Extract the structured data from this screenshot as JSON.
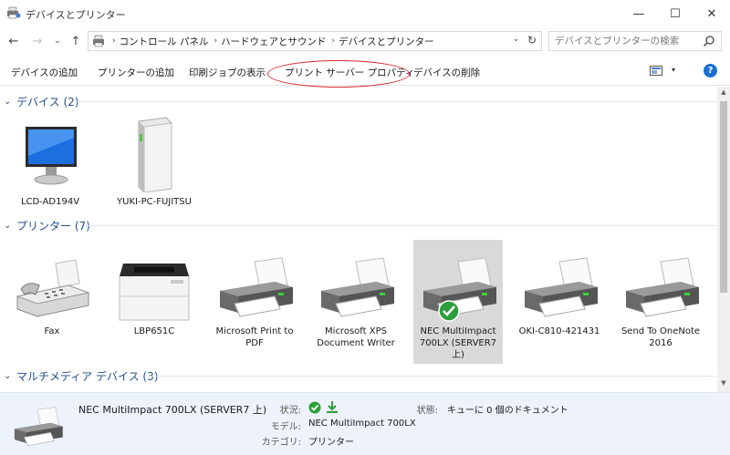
{
  "window": {
    "title": "デバイスとプリンター",
    "min_glyph": "—",
    "max_glyph": "☐",
    "close_glyph": "✕"
  },
  "nav": {
    "back_glyph": "←",
    "forward_glyph": "→",
    "recent_glyph": "⌄",
    "up_glyph": "↑",
    "breadcrumbs": [
      "コントロール パネル",
      "ハードウェアとサウンド",
      "デバイスとプリンター"
    ],
    "breadcrumb_sep": "›",
    "dropdown_glyph": "⌄",
    "refresh_glyph": "↻",
    "search_placeholder": "デバイスとプリンターの検索"
  },
  "commands": [
    {
      "label": "デバイスの追加"
    },
    {
      "label": "プリンターの追加"
    },
    {
      "label": "印刷ジョブの表示"
    },
    {
      "label": "プリント サーバー プロパティ",
      "highlighted": true
    },
    {
      "label": "デバイスの削除"
    }
  ],
  "help_label": "?",
  "view_dropdown_glyph": "▾",
  "groups": {
    "devices": {
      "title": "デバイス (2)",
      "items": [
        {
          "label": "LCD-AD194V",
          "icon": "monitor-icon"
        },
        {
          "label": "YUKI-PC-FUJITSU",
          "icon": "computer-tower-icon"
        }
      ]
    },
    "printers": {
      "title": "プリンター (7)",
      "items": [
        {
          "label": "Fax",
          "icon": "fax-icon"
        },
        {
          "label": "LBP651C",
          "icon": "laser-printer-icon"
        },
        {
          "label": "Microsoft Print to PDF",
          "icon": "printer-icon"
        },
        {
          "label": "Microsoft XPS Document Writer",
          "icon": "printer-icon"
        },
        {
          "label": "NEC MultiImpact 700LX (SERVER7 上)",
          "icon": "printer-icon",
          "default": true,
          "selected": true
        },
        {
          "label": "OKI-C810-421431",
          "icon": "printer-icon"
        },
        {
          "label": "Send To OneNote 2016",
          "icon": "printer-icon"
        }
      ]
    },
    "multimedia": {
      "title": "マルチメディア デバイス (3)"
    }
  },
  "details": {
    "name": "NEC MultiImpact 700LX (SERVER7 上)",
    "status_key": "状況:",
    "model_key": "モデル:",
    "model_value": "NEC MultiImpact 700LX",
    "category_key": "カテゴリ:",
    "category_value": "プリンター",
    "state_key": "状態:",
    "state_value": "キューに 0 個のドキュメント"
  },
  "colors": {
    "group_header": "#1f4e8c",
    "highlight_ellipse": "#d9262b",
    "selected_tile": "#d9d9d9",
    "details_pane": "#eef3fb",
    "default_check": "#2e9e3a",
    "help": "#1a6fd1"
  }
}
